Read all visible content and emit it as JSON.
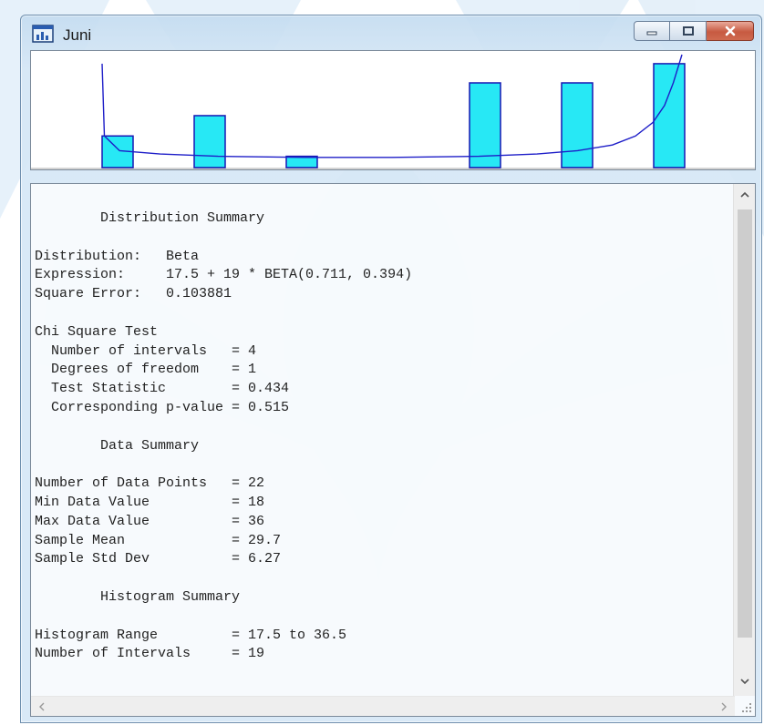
{
  "window": {
    "title": "Juni",
    "title_bar_color": "#c4dcf0",
    "close_button_color": "#c75a41"
  },
  "caption_buttons": [
    "minimize-icon",
    "maximize-icon",
    "close-icon"
  ],
  "chart_data": {
    "type": "bar",
    "description_source": "histogram with fitted Beta density curve (no axes or tick labels printed)",
    "bar_fill": "#27e8f5",
    "bar_stroke": "#1616b4",
    "curve_color": "#1e1ec8",
    "bars": [
      {
        "interval": 1,
        "relative_height": 0.28
      },
      {
        "interval": 2,
        "relative_height": 0.46
      },
      {
        "interval": 3,
        "relative_height": 0.1
      },
      {
        "interval": 4,
        "relative_height": 0.75
      },
      {
        "interval": 5,
        "relative_height": 0.75
      },
      {
        "interval": 6,
        "relative_height": 0.92
      }
    ],
    "fitted_curve": [
      [
        0.0,
        0.92
      ],
      [
        0.004,
        0.28
      ],
      [
        0.03,
        0.15
      ],
      [
        0.1,
        0.12
      ],
      [
        0.2,
        0.1
      ],
      [
        0.35,
        0.09
      ],
      [
        0.5,
        0.09
      ],
      [
        0.65,
        0.1
      ],
      [
        0.75,
        0.12
      ],
      [
        0.82,
        0.15
      ],
      [
        0.88,
        0.2
      ],
      [
        0.92,
        0.28
      ],
      [
        0.95,
        0.4
      ],
      [
        0.97,
        0.55
      ],
      [
        0.985,
        0.75
      ],
      [
        1.0,
        1.0
      ]
    ]
  },
  "report": {
    "lines": [
      "        Distribution Summary",
      "",
      "Distribution:   Beta",
      "Expression:     17.5 + 19 * BETA(0.711, 0.394)",
      "Square Error:   0.103881",
      "",
      "Chi Square Test",
      "  Number of intervals   = 4",
      "  Degrees of freedom    = 1",
      "  Test Statistic        = 0.434",
      "  Corresponding p-value = 0.515",
      "",
      "        Data Summary",
      "",
      "Number of Data Points   = 22",
      "Min Data Value          = 18",
      "Max Data Value          = 36",
      "Sample Mean             = 29.7",
      "Sample Std Dev          = 6.27",
      "",
      "        Histogram Summary",
      "",
      "Histogram Range         = 17.5 to 36.5",
      "Number of Intervals     = 19"
    ]
  },
  "scrollbars": {
    "vertical": [
      "chevron-up-icon",
      "chevron-down-icon"
    ],
    "horizontal": [
      "chevron-left-icon",
      "chevron-right-icon"
    ]
  }
}
